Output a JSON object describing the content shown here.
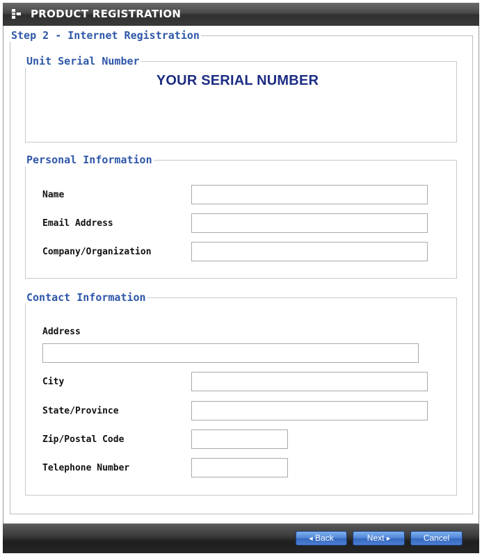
{
  "window": {
    "title": "PRODUCT REGISTRATION",
    "icon": "window-icon"
  },
  "step": {
    "legend": "Step 2 - Internet Registration"
  },
  "serial": {
    "legend": "Unit Serial Number",
    "value": "YOUR SERIAL NUMBER"
  },
  "personal": {
    "legend": "Personal Information",
    "fields": {
      "name": {
        "label": "Name",
        "value": ""
      },
      "email": {
        "label": "Email Address",
        "value": ""
      },
      "company": {
        "label": "Company/Organization",
        "value": ""
      }
    }
  },
  "contact": {
    "legend": "Contact Information",
    "fields": {
      "address": {
        "label": "Address",
        "value": ""
      },
      "city": {
        "label": "City",
        "value": ""
      },
      "state": {
        "label": "State/Province",
        "value": ""
      },
      "zip": {
        "label": "Zip/Postal Code",
        "value": ""
      },
      "phone": {
        "label": "Telephone Number",
        "value": ""
      }
    }
  },
  "buttons": {
    "back": {
      "label": "Back",
      "icon": "left-triangle-icon"
    },
    "next": {
      "label": "Next",
      "icon": "right-triangle-icon"
    },
    "cancel": {
      "label": "Cancel"
    }
  },
  "colors": {
    "legend": "#2e57a8",
    "serial_text": "#1d2d83",
    "button_blue": "#4f86d6",
    "titlebar": "#3a3a3a"
  }
}
